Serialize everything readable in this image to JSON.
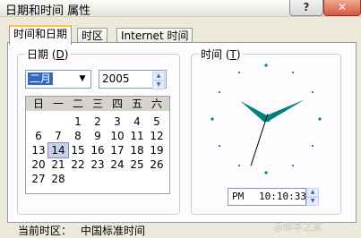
{
  "window": {
    "title": "日期和时间 属性",
    "help_label": "?",
    "close_label": "✕"
  },
  "tabs": [
    {
      "label": "时间和日期"
    },
    {
      "label": "时区"
    },
    {
      "label": "Internet 时间"
    }
  ],
  "date_group": {
    "title": "日期",
    "mnemonic_pre": "(",
    "mnemonic": "D",
    "mnemonic_post": ")",
    "month": "二月",
    "year": "2005",
    "weekdays": [
      "日",
      "一",
      "二",
      "三",
      "四",
      "五",
      "六"
    ],
    "weeks": [
      [
        "",
        "",
        "1",
        "2",
        "3",
        "4",
        "5"
      ],
      [
        "6",
        "7",
        "8",
        "9",
        "10",
        "11",
        "12"
      ],
      [
        "13",
        "14",
        "15",
        "16",
        "17",
        "18",
        "19"
      ],
      [
        "20",
        "21",
        "22",
        "23",
        "24",
        "25",
        "26"
      ],
      [
        "27",
        "28",
        "",
        "",
        "",
        "",
        ""
      ]
    ],
    "selected_day": "14"
  },
  "time_group": {
    "title": "时间",
    "mnemonic_pre": "(",
    "mnemonic": "T",
    "mnemonic_post": ")",
    "ampm": "PM",
    "time": "10:10:33",
    "hour": 10,
    "minute": 10,
    "second": 33,
    "hand_color": "#008080"
  },
  "timezone": {
    "label": "当前时区：",
    "value": "中国标准时间"
  },
  "watermark": "@脚本之家"
}
